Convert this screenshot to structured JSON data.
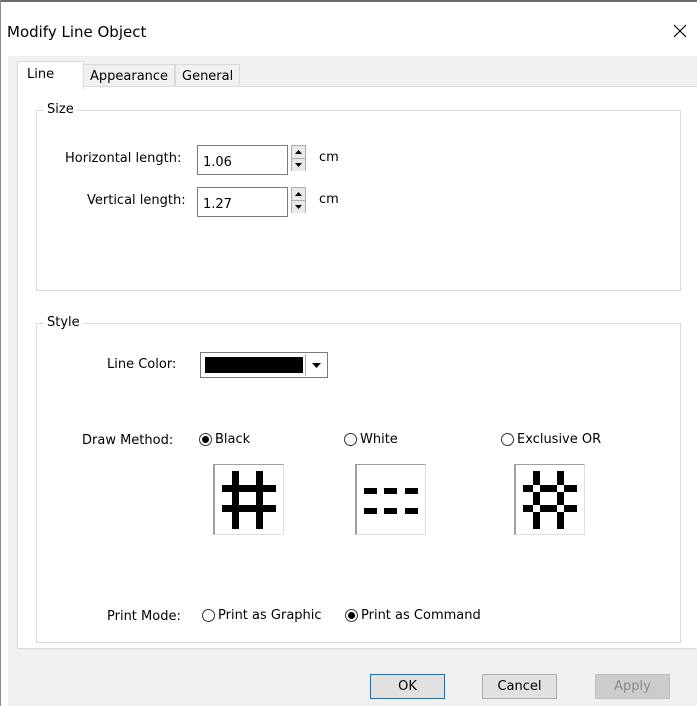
{
  "dialog": {
    "title": "Modify Line Object"
  },
  "tabs": [
    {
      "label": "Line"
    },
    {
      "label": "Appearance"
    },
    {
      "label": "General"
    }
  ],
  "size_group": {
    "label": "Size",
    "horizontal_label": "Horizontal length:",
    "horizontal_value": "1.06",
    "horizontal_unit": "cm",
    "vertical_label": "Vertical length:",
    "vertical_value": "1.27",
    "vertical_unit": "cm"
  },
  "style_group": {
    "label": "Style",
    "line_color_label": "Line Color:",
    "line_color_value": "#000000",
    "draw_method_label": "Draw Method:",
    "draw_methods": [
      {
        "label": "Black",
        "selected": true
      },
      {
        "label": "White",
        "selected": false
      },
      {
        "label": "Exclusive OR",
        "selected": false
      }
    ],
    "print_mode_label": "Print Mode:",
    "print_modes": [
      {
        "label": "Print as Graphic",
        "selected": false
      },
      {
        "label": "Print as Command",
        "selected": true
      }
    ]
  },
  "buttons": {
    "ok": "OK",
    "cancel": "Cancel",
    "apply": "Apply"
  },
  "colors": {
    "focus_border": "#0078d7",
    "client_bg": "#f0f0f0"
  }
}
